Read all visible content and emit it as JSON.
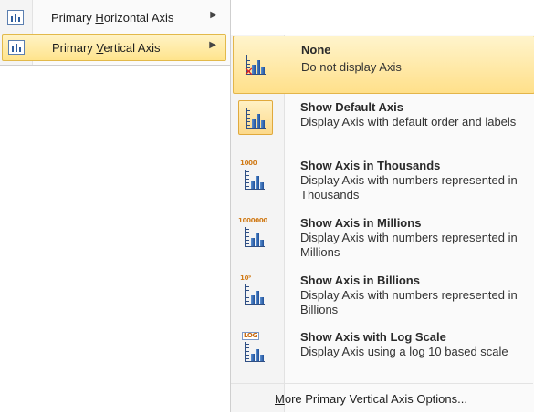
{
  "parent_menu": {
    "items": [
      {
        "pre": "Primary ",
        "key": "H",
        "post": "orizontal Axis",
        "arrow": "▶"
      },
      {
        "pre": "Primary ",
        "key": "V",
        "post": "ertical Axis",
        "arrow": "▶"
      }
    ]
  },
  "submenu": {
    "items": [
      {
        "title": "None",
        "desc": "Do not display Axis",
        "icon": "no-axis-icon"
      },
      {
        "title": "Show Default Axis",
        "desc": "Display Axis with default order and labels",
        "icon": "default-axis-icon"
      },
      {
        "title": "Show Axis in Thousands",
        "desc": "Display Axis with numbers represented in Thousands",
        "icon": "thousands-axis-icon",
        "tag": "1000"
      },
      {
        "title": "Show Axis in Millions",
        "desc": "Display Axis with numbers represented in Millions",
        "icon": "millions-axis-icon",
        "tag": "1000000"
      },
      {
        "title": "Show Axis in Billions",
        "desc": "Display Axis with numbers represented in Billions",
        "icon": "billions-axis-icon",
        "tag": "10⁹"
      },
      {
        "title": "Show Axis with Log Scale",
        "desc": "Display Axis using a log 10 based scale",
        "icon": "log-scale-axis-icon",
        "tag": "LOG"
      }
    ],
    "more": {
      "key": "M",
      "rest": "ore Primary Vertical Axis Options..."
    }
  },
  "colors": {
    "highlight": "#ffe48c",
    "highlight_border": "#e2b94a",
    "accent_icon": "#2f5e9e",
    "tag": "#d07a16"
  }
}
